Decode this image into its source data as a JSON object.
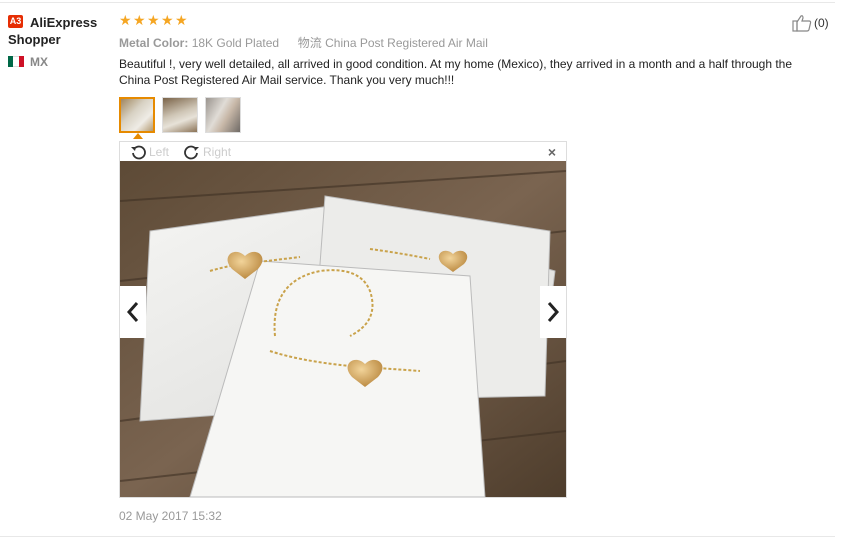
{
  "reviewer": {
    "badge": "A3",
    "name": "AliExpress Shopper",
    "country": "MX",
    "flag_colors": [
      "#006847",
      "#ffffff",
      "#ce1126"
    ]
  },
  "rating": {
    "stars": 5,
    "color": "#f5a623"
  },
  "attributes": {
    "metal_color_label": "Metal Color:",
    "metal_color_value": "18K Gold Plated",
    "shipping_icon_text": "物流",
    "shipping_value": "China Post Registered Air Mail"
  },
  "helpful": {
    "icon": "thumbs-up-icon",
    "count": "(0)"
  },
  "review_text": "Beautiful !, very well detailed, all arrived in good condition. At my home (Mexico), they arrived in a month and a half through the China Post Registered Air Mail service. Thank you very much!!!",
  "thumbnails": [
    {
      "name": "thumbnail-1",
      "active": true
    },
    {
      "name": "thumbnail-2",
      "active": false
    },
    {
      "name": "thumbnail-3",
      "active": false
    }
  ],
  "viewer": {
    "rotate_left_label": "Left",
    "rotate_right_label": "Right",
    "close_symbol": "×",
    "prev_icon": "chevron-left-icon",
    "next_icon": "chevron-right-icon"
  },
  "date": "02 May 2017 15:32",
  "colors": {
    "accent": "#e68a00",
    "badge": "#e62e04"
  }
}
